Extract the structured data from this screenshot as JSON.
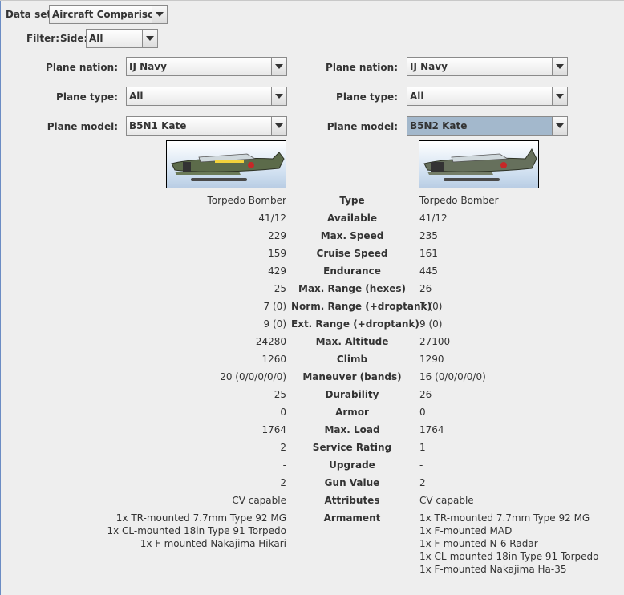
{
  "header": {
    "data_set_label": "Data set:",
    "data_set_value": "Aircraft Comparison",
    "filter_label": "Filter:",
    "side_label": "Side:",
    "side_value": "All"
  },
  "left": {
    "nation_label": "Plane nation:",
    "nation_value": "IJ Navy",
    "type_label": "Plane type:",
    "type_value": "All",
    "model_label": "Plane model:",
    "model_value": "B5N1 Kate"
  },
  "right": {
    "nation_label": "Plane nation:",
    "nation_value": "IJ Navy",
    "type_label": "Plane type:",
    "type_value": "All",
    "model_label": "Plane model:",
    "model_value": "B5N2 Kate"
  },
  "stats": [
    {
      "label": "Type",
      "left": "Torpedo Bomber",
      "right": "Torpedo Bomber"
    },
    {
      "label": "Available",
      "left": "41/12",
      "right": "41/12"
    },
    {
      "label": "Max. Speed",
      "left": "229",
      "right": "235"
    },
    {
      "label": "Cruise Speed",
      "left": "159",
      "right": "161"
    },
    {
      "label": "Endurance",
      "left": "429",
      "right": "445"
    },
    {
      "label": "Max. Range (hexes)",
      "left": "25",
      "right": "26"
    },
    {
      "label": "Norm. Range (+droptank)",
      "left": "7 (0)",
      "right": "7 (0)"
    },
    {
      "label": "Ext. Range (+droptank)",
      "left": "9 (0)",
      "right": "9 (0)"
    },
    {
      "label": "Max. Altitude",
      "left": "24280",
      "right": "27100"
    },
    {
      "label": "Climb",
      "left": "1260",
      "right": "1290"
    },
    {
      "label": "Maneuver (bands)",
      "left": "20 (0/0/0/0/0)",
      "right": "16 (0/0/0/0/0)"
    },
    {
      "label": "Durability",
      "left": "25",
      "right": "26"
    },
    {
      "label": "Armor",
      "left": "0",
      "right": "0"
    },
    {
      "label": "Max. Load",
      "left": "1764",
      "right": "1764"
    },
    {
      "label": "Service Rating",
      "left": "2",
      "right": "1"
    },
    {
      "label": "Upgrade",
      "left": "-",
      "right": "-"
    },
    {
      "label": "Gun Value",
      "left": "2",
      "right": "2"
    },
    {
      "label": "Attributes",
      "left": "CV capable",
      "right": "CV capable"
    }
  ],
  "armament": {
    "label": "Armament",
    "left": [
      "1x TR-mounted 7.7mm Type 92 MG",
      "1x CL-mounted 18in Type 91 Torpedo",
      "1x F-mounted Nakajima Hikari"
    ],
    "right": [
      "1x TR-mounted 7.7mm Type 92 MG",
      "1x F-mounted MAD",
      "1x F-mounted N-6 Radar",
      "1x CL-mounted 18in Type 91 Torpedo",
      "1x F-mounted Nakajima Ha-35"
    ]
  },
  "colors": {
    "background": "#eeeeee",
    "selected_combo": "#a3b8cc",
    "window_edge": "#6b8cc4"
  }
}
